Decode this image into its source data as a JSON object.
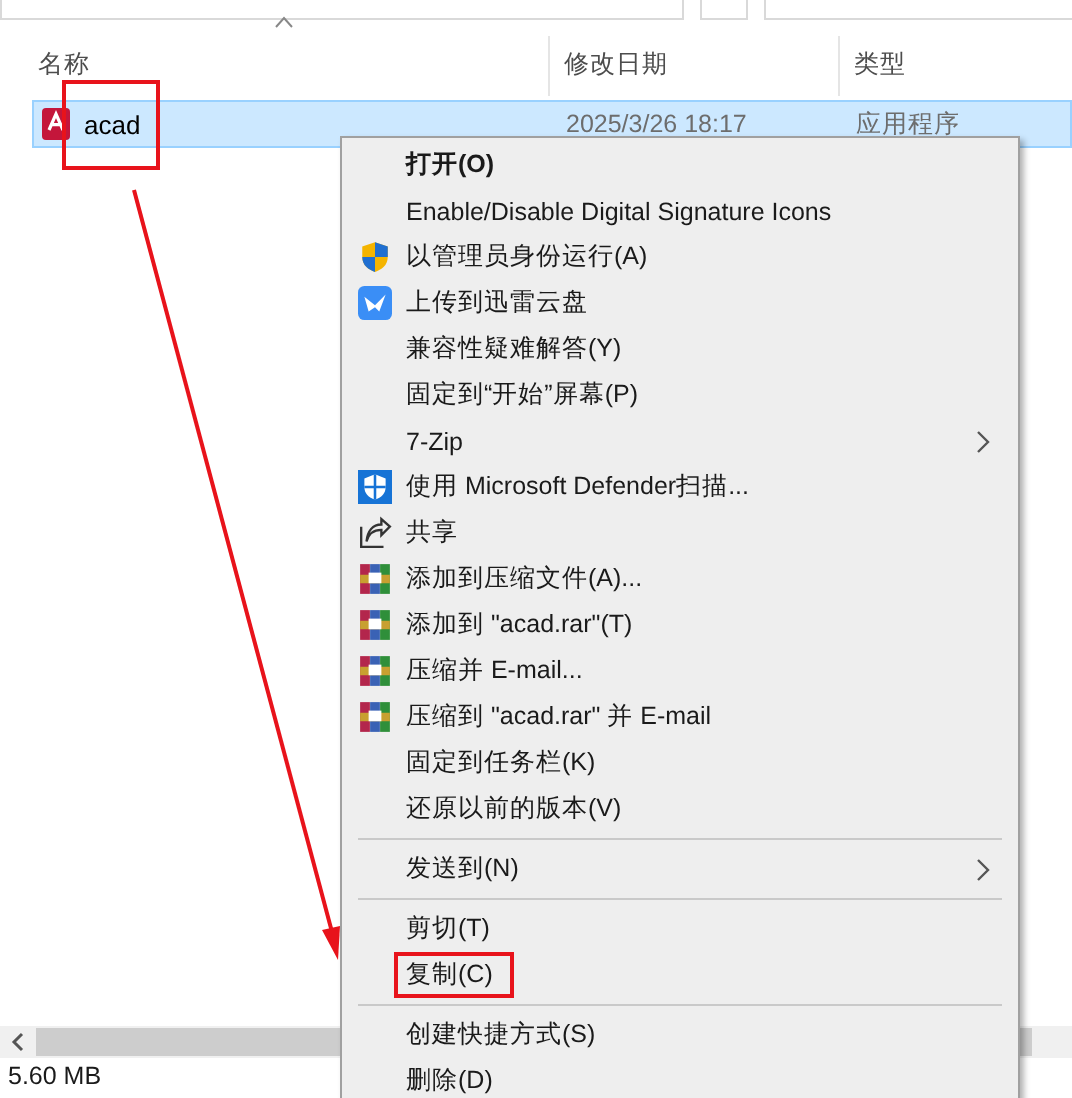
{
  "columns": [
    {
      "label": "名称",
      "sorted": true
    },
    {
      "label": "修改日期",
      "sorted": false
    },
    {
      "label": "类型",
      "sorted": false
    }
  ],
  "files": [
    {
      "name": "acad",
      "modified": "2025/3/26 18:17",
      "type": "应用程序",
      "selected": true,
      "marked": true
    }
  ],
  "context_menu": [
    {
      "kind": "plain",
      "label": "打开(O)",
      "bold": true,
      "submenu": false,
      "marked": false
    },
    {
      "kind": "plain",
      "label": "Enable/Disable Digital Signature Icons",
      "bold": false,
      "submenu": false,
      "marked": false
    },
    {
      "kind": "uac",
      "label": "以管理员身份运行(A)",
      "bold": false,
      "submenu": false,
      "marked": false
    },
    {
      "kind": "upload",
      "label": "上传到迅雷云盘",
      "bold": false,
      "submenu": false,
      "marked": false
    },
    {
      "kind": "plain",
      "label": "兼容性疑难解答(Y)",
      "bold": false,
      "submenu": false,
      "marked": false
    },
    {
      "kind": "plain",
      "label": "固定到“开始”屏幕(P)",
      "bold": false,
      "submenu": false,
      "marked": false
    },
    {
      "kind": "plain",
      "label": "7-Zip",
      "bold": false,
      "submenu": true,
      "marked": false
    },
    {
      "kind": "defender",
      "label": "使用 Microsoft Defender扫描...",
      "bold": false,
      "submenu": false,
      "marked": false
    },
    {
      "kind": "share",
      "label": "共享",
      "bold": false,
      "submenu": false,
      "marked": false
    },
    {
      "kind": "archive",
      "label": "添加到压缩文件(A)...",
      "bold": false,
      "submenu": false,
      "marked": false
    },
    {
      "kind": "archive",
      "label": "添加到 \"acad.rar\"(T)",
      "bold": false,
      "submenu": false,
      "marked": false
    },
    {
      "kind": "archive",
      "label": "压缩并 E-mail...",
      "bold": false,
      "submenu": false,
      "marked": false
    },
    {
      "kind": "archive",
      "label": "压缩到 \"acad.rar\" 并 E-mail",
      "bold": false,
      "submenu": false,
      "marked": false
    },
    {
      "kind": "plain",
      "label": "固定到任务栏(K)",
      "bold": false,
      "submenu": false,
      "marked": false
    },
    {
      "kind": "plain",
      "label": "还原以前的版本(V)",
      "bold": false,
      "submenu": false,
      "marked": false
    },
    {
      "kind": "separator"
    },
    {
      "kind": "plain",
      "label": "发送到(N)",
      "bold": false,
      "submenu": true,
      "marked": false
    },
    {
      "kind": "separator"
    },
    {
      "kind": "plain",
      "label": "剪切(T)",
      "bold": false,
      "submenu": false,
      "marked": false
    },
    {
      "kind": "plain",
      "label": "复制(C)",
      "bold": false,
      "submenu": false,
      "marked": true
    },
    {
      "kind": "separator"
    },
    {
      "kind": "plain",
      "label": "创建快捷方式(S)",
      "bold": false,
      "submenu": false,
      "marked": false
    },
    {
      "kind": "plain",
      "label": "删除(D)",
      "bold": false,
      "submenu": false,
      "marked": false
    }
  ],
  "status_bar": {
    "size": "5.60 MB"
  }
}
